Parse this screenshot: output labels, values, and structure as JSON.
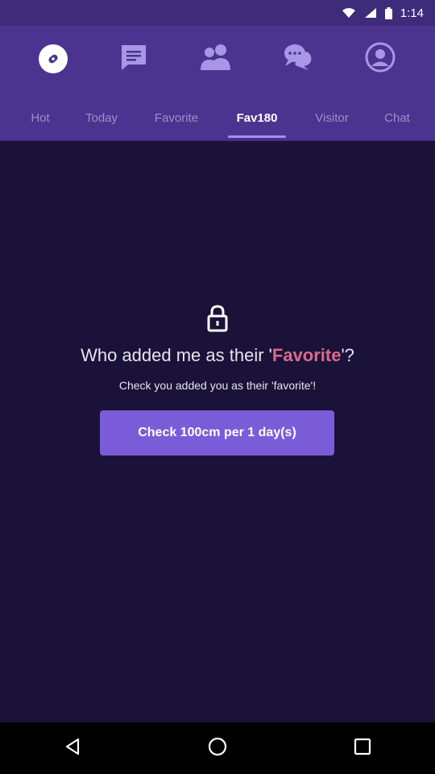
{
  "status_bar": {
    "time": "1:14"
  },
  "icon_tabs": [
    {
      "icon": "compass-icon",
      "active": true
    },
    {
      "icon": "message-icon",
      "active": false
    },
    {
      "icon": "people-icon",
      "active": false
    },
    {
      "icon": "chat-bubbles-icon",
      "active": false
    },
    {
      "icon": "profile-icon",
      "active": false
    }
  ],
  "tabs": [
    "Hot",
    "Today",
    "Favorite",
    "Fav180",
    "Visitor",
    "Chat"
  ],
  "active_tab": "Fav180",
  "main": {
    "headline_prefix": "Who added me as their '",
    "headline_highlight": "Favorite",
    "headline_suffix": "'?",
    "subline": "Check you added you as their 'favorite'!",
    "button_label": "Check 100cm per 1 day(s)"
  },
  "colors": {
    "header": "#4a3490",
    "background": "#1a1238",
    "accent": "#7a5cd8",
    "highlight": "#d96b8f"
  }
}
